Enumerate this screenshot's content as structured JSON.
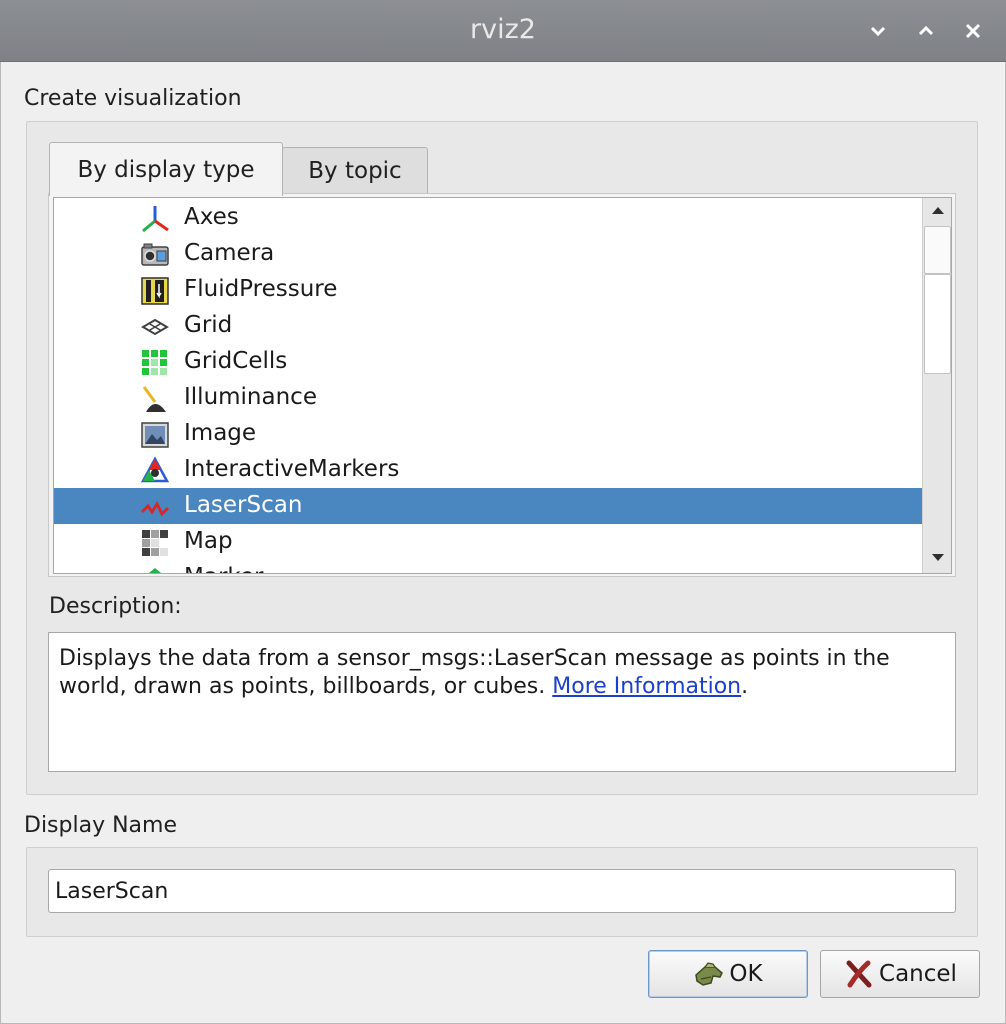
{
  "window": {
    "title": "rviz2",
    "controls": {
      "minimize": "minimize",
      "maximize": "maximize",
      "close": "close"
    }
  },
  "create_label": "Create visualization",
  "tabs": [
    {
      "label": "By display type",
      "active": true
    },
    {
      "label": "By topic",
      "active": false
    }
  ],
  "display_types": [
    {
      "label": "Axes",
      "icon": "axes-icon"
    },
    {
      "label": "Camera",
      "icon": "camera-icon"
    },
    {
      "label": "FluidPressure",
      "icon": "fluid-pressure-icon"
    },
    {
      "label": "Grid",
      "icon": "grid-icon"
    },
    {
      "label": "GridCells",
      "icon": "grid-cells-icon"
    },
    {
      "label": "Illuminance",
      "icon": "illuminance-icon"
    },
    {
      "label": "Image",
      "icon": "image-icon"
    },
    {
      "label": "InteractiveMarkers",
      "icon": "interactive-markers-icon"
    },
    {
      "label": "LaserScan",
      "icon": "laser-scan-icon",
      "selected": true
    },
    {
      "label": "Map",
      "icon": "map-icon"
    },
    {
      "label": "Marker",
      "icon": "marker-icon"
    }
  ],
  "description_label": "Description:",
  "description": {
    "text": "Displays the data from a sensor_msgs::LaserScan message as points in the world, drawn as points, billboards, or cubes. ",
    "link_text": "More Information",
    "after_link": "."
  },
  "display_name_label": "Display Name",
  "display_name_value": "LaserScan",
  "buttons": {
    "ok": "OK",
    "cancel": "Cancel"
  },
  "colors": {
    "selection": "#4a86c0",
    "titlebar": "#85888c",
    "link": "#1b3fcf"
  }
}
